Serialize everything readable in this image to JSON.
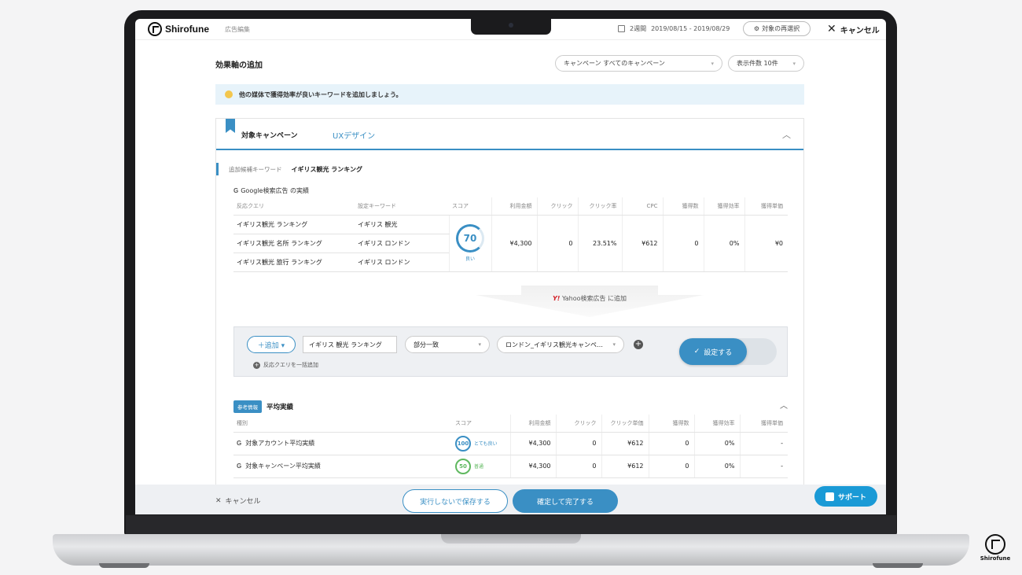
{
  "header": {
    "logo_text": "Shirofune",
    "breadcrumb": "広告編集",
    "period_label": "2週間",
    "date_range": "2019/08/15 - 2019/08/29",
    "reselect_label": "対象の再選択",
    "cancel_label": "キャンセル"
  },
  "page": {
    "title": "効果軸の追加",
    "campaign_select": "キャンペーン すべてのキャンペーン",
    "count_select": "表示件数 10件",
    "tip": "他の媒体で獲得効率が良いキーワードを追加しましょう。"
  },
  "card": {
    "label": "対象キャンペーン",
    "value": "UXデザイン",
    "candidate_label": "追加候補キーワード",
    "candidate_value": "イギリス観光 ランキング"
  },
  "google_table": {
    "title": "Google検索広告 の実績",
    "headers": [
      "反応クエリ",
      "設定キーワード",
      "スコア",
      "利用金額",
      "クリック",
      "クリック率",
      "CPC",
      "獲得数",
      "獲得効率",
      "獲得単価"
    ],
    "rows": [
      {
        "query": "イギリス観光 ランキング",
        "keyword": "イギリス 観光"
      },
      {
        "query": "イギリス観光 名所 ランキング",
        "keyword": "イギリス ロンドン"
      },
      {
        "query": "イギリス観光 旅行 ランキング",
        "keyword": "イギリス ロンドン"
      }
    ],
    "score": "70",
    "score_label": "良い",
    "cost": "¥4,300",
    "clicks": "0",
    "ctr": "23.51%",
    "cpc": "¥612",
    "conversions": "0",
    "efficiency": "0%",
    "cpa": "¥0"
  },
  "transfer": {
    "logo": "Y!",
    "text": "Yahoo検索広告 に追加"
  },
  "add_panel": {
    "add_button": "＋追加 ▾",
    "keyword_value": "イギリス 観光 ランキング",
    "match_type": "部分一致",
    "campaign": "ロンドン_イギリス観光キャンペ…",
    "bulk_add": "反応クエリを一括追加",
    "set_button": "設定する"
  },
  "reference": {
    "badge": "参考情報",
    "title": "平均実績",
    "headers": [
      "種別",
      "スコア",
      "利用金額",
      "クリック",
      "クリック単価",
      "獲得数",
      "獲得効率",
      "獲得単価"
    ],
    "rows": [
      {
        "name": "対象アカウント平均実績",
        "score": "100",
        "score_label": "とても良い",
        "cost": "¥4,300",
        "clicks": "0",
        "cpc": "¥612",
        "conversions": "0",
        "efficiency": "0%",
        "cpa": "-"
      },
      {
        "name": "対象キャンペーン平均実績",
        "score": "50",
        "score_label": "普通",
        "cost": "¥4,300",
        "clicks": "0",
        "cpc": "¥612",
        "conversions": "0",
        "efficiency": "0%",
        "cpa": "-"
      }
    ]
  },
  "footer": {
    "cancel": "キャンセル",
    "save_without_run": "実行しないで保存する",
    "confirm": "確定して完了する",
    "support": "サポート"
  },
  "corner_logo_text": "Shirofune",
  "colors": {
    "accent": "#3a8fc4",
    "support": "#1a9ad6",
    "yahoo": "#d3222a"
  }
}
